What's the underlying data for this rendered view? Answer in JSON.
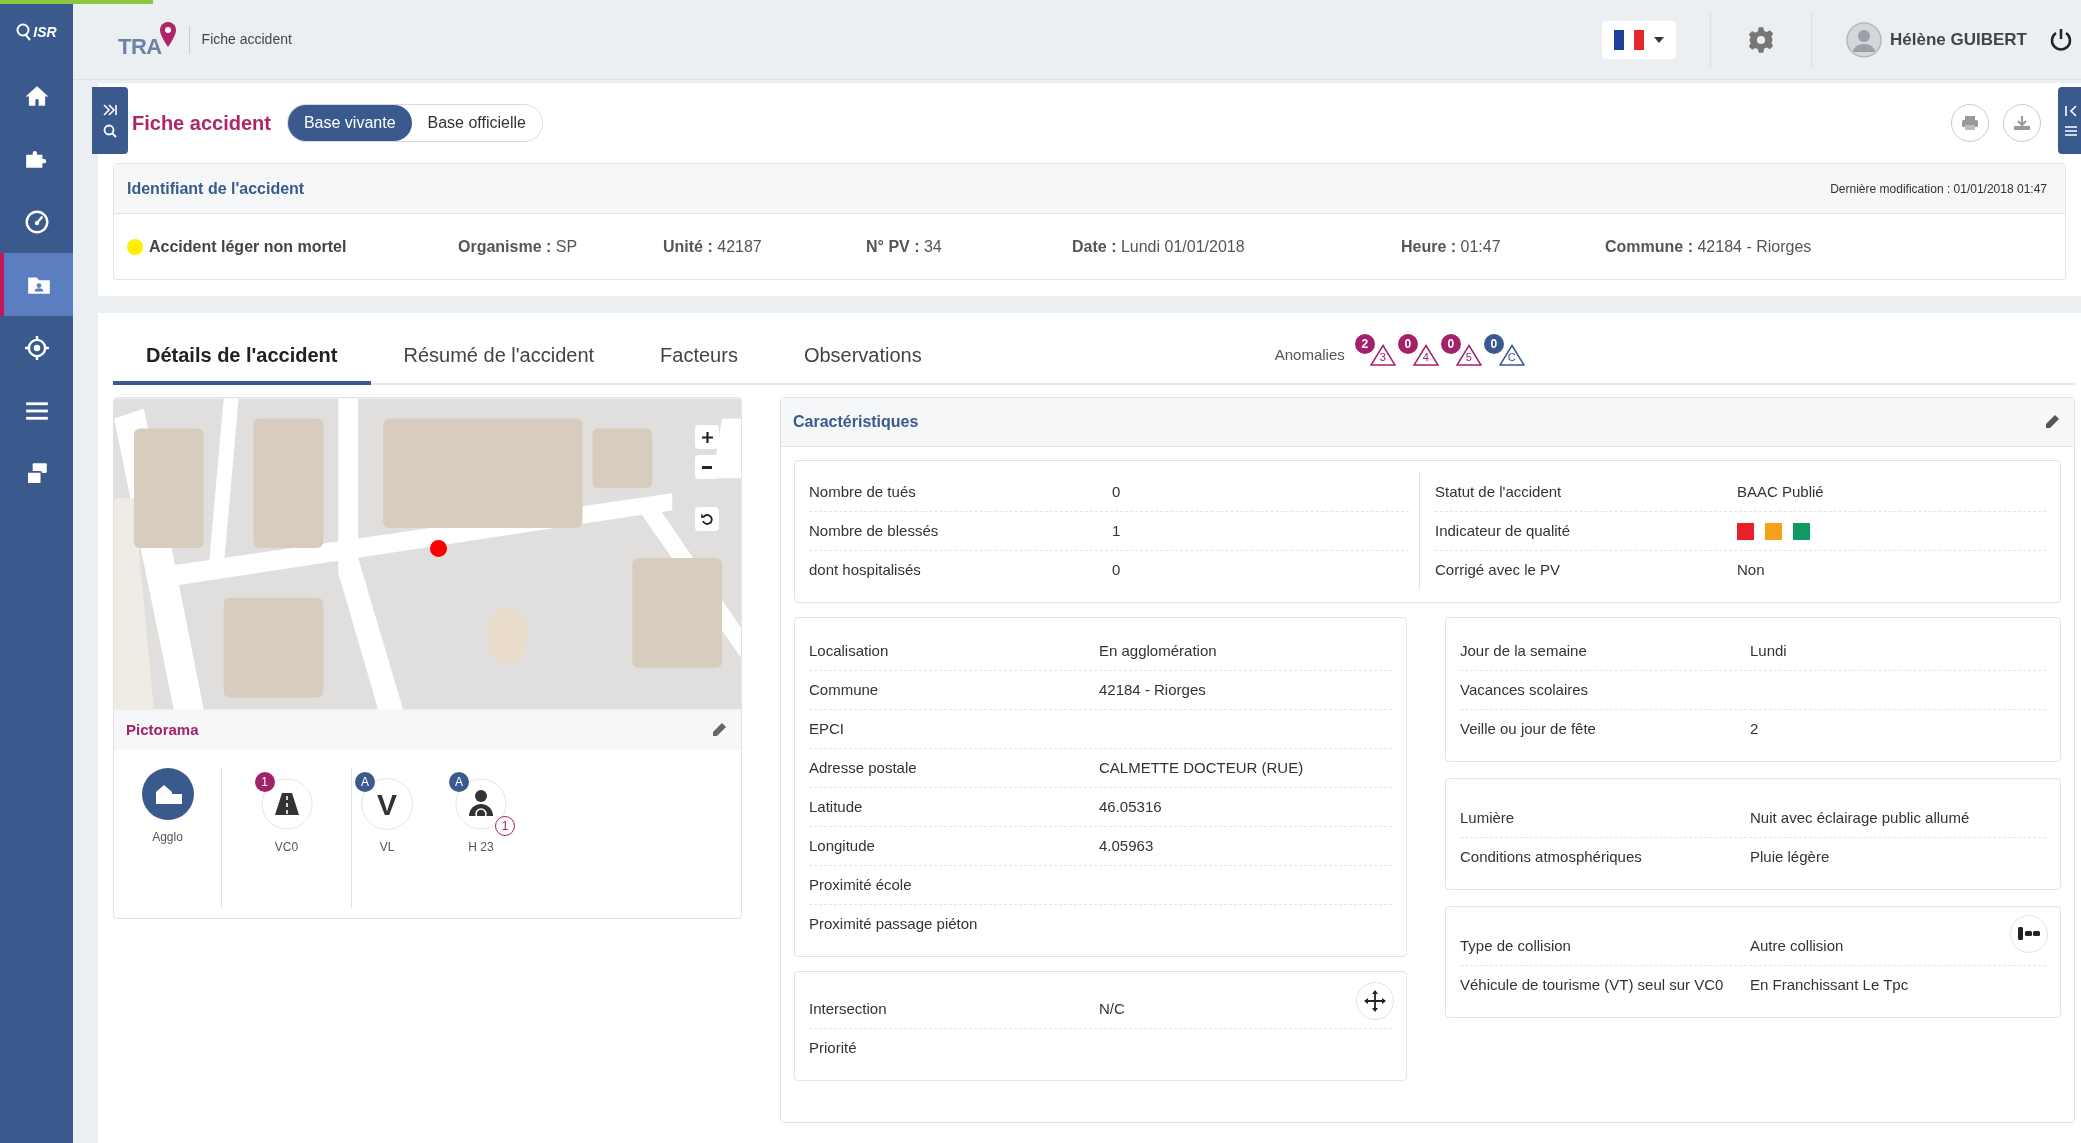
{
  "top_bar": {
    "logo": "ISR",
    "product": "TRA",
    "breadcrumb": "Fiche accident",
    "user_name": "Hélène GUIBERT"
  },
  "sidebar": {
    "items": [
      {
        "kind": "home",
        "selected": false
      },
      {
        "kind": "puzzle",
        "selected": false
      },
      {
        "kind": "gauge",
        "selected": false
      },
      {
        "kind": "folder",
        "selected": true
      },
      {
        "kind": "target",
        "selected": false
      },
      {
        "kind": "menu",
        "selected": false
      },
      {
        "kind": "stack",
        "selected": false
      }
    ]
  },
  "header": {
    "title": "Fiche accident",
    "base_toggle": [
      {
        "label": "Base vivante",
        "selected": true
      },
      {
        "label": "Base officielle",
        "selected": false
      }
    ]
  },
  "identification": {
    "title": "Identifiant de l'accident",
    "last_modified": "Dernière modification : 01/01/2018 01:47",
    "severity": {
      "label": "Accident léger non mortel",
      "color": "#ffee00"
    },
    "fields": [
      "**Organisme :** SP",
      "**Unité :** 42187",
      "**N° PV :** 34",
      "**Date :** Lundi 01/01/2018",
      "**Heure :** 01:47",
      "**Commune :** 42184 - Riorges"
    ]
  },
  "tabs": [
    {
      "label": "Détails de l'accident",
      "selected": true
    },
    {
      "label": "Résumé de l'accident",
      "selected": false
    },
    {
      "label": "Facteurs",
      "selected": false
    },
    {
      "label": "Observations",
      "selected": false
    }
  ],
  "anomalies": {
    "label": "Anomalies",
    "items": [
      {
        "count": "2",
        "code": "3",
        "color": "#a3216b"
      },
      {
        "count": "0",
        "code": "4",
        "color": "#a3216b"
      },
      {
        "count": "0",
        "code": "5",
        "color": "#a3216b"
      },
      {
        "count": "0",
        "code": "C",
        "color": "#3a5a8e"
      }
    ]
  },
  "pictorama": {
    "title": "Pictorama",
    "items": [
      {
        "kind": "agglo",
        "label": "Agglo",
        "divider_after": true
      },
      {
        "kind": "road",
        "label": "VC0",
        "badge": "1",
        "color": "#a3216b",
        "divider_after": true
      },
      {
        "kind": "vehicle",
        "label": "VL",
        "glyph": "V",
        "badge": "A",
        "color": "#3a5a8e",
        "divider_after": false
      },
      {
        "kind": "person",
        "label": "H 23",
        "badge": "A",
        "color": "#3a5a8e",
        "sub_badge": "1",
        "divider_after": false
      }
    ]
  },
  "characteristics": {
    "title": "Caractéristiques",
    "summary": {
      "left": [
        {
          "label": "Nombre de tués",
          "value": "0"
        },
        {
          "label": "Nombre de blessés",
          "value": "1"
        },
        {
          "label": "dont hospitalisés",
          "value": "0"
        }
      ],
      "right": [
        {
          "kind": "text",
          "label": "Statut de l'accident",
          "value": "BAAC Publié"
        },
        {
          "kind": "swatches",
          "label": "Indicateur de qualité",
          "swatches": [
            {
              "color": "#e8202a"
            },
            {
              "color": "#f5a11c"
            },
            {
              "color": "#0f9963"
            }
          ]
        },
        {
          "kind": "text",
          "label": "Corrigé avec le PV",
          "value": "Non"
        }
      ]
    },
    "left_cards": [
      {
        "rows": [
          {
            "label": "Localisation",
            "value": "En agglomération"
          },
          {
            "label": "Commune",
            "value": "42184 - Riorges"
          },
          {
            "label": "EPCI"
          },
          {
            "label": "Adresse postale",
            "value": "CALMETTE DOCTEUR (RUE)"
          },
          {
            "label": "Latitude",
            "value": "46.05316"
          },
          {
            "label": "Longitude",
            "value": "4.05963"
          },
          {
            "label": "Proximité école"
          },
          {
            "label": "Proximité passage piéton"
          }
        ]
      },
      {
        "kind": "move",
        "rows": [
          {
            "label": "Intersection",
            "value": "N/C"
          },
          {
            "label": "Priorité"
          }
        ]
      }
    ],
    "right_cards": [
      {
        "rows": [
          {
            "label": "Jour de la semaine",
            "value": "Lundi"
          },
          {
            "label": "Vacances scolaires"
          },
          {
            "label": "Veille ou jour de fête",
            "value": "2"
          }
        ]
      },
      {
        "rows": [
          {
            "label": "Lumière",
            "value": "Nuit avec éclairage public allumé"
          },
          {
            "label": "Conditions atmosphériques",
            "value": "Pluie légère"
          }
        ]
      },
      {
        "kind": "collision",
        "rows": [
          {
            "label": "Type de collision",
            "value": "Autre collision"
          },
          {
            "label": "Véhicule de tourisme (VT) seul sur VC0",
            "value": "En Franchissant Le Tpc"
          }
        ]
      }
    ]
  }
}
